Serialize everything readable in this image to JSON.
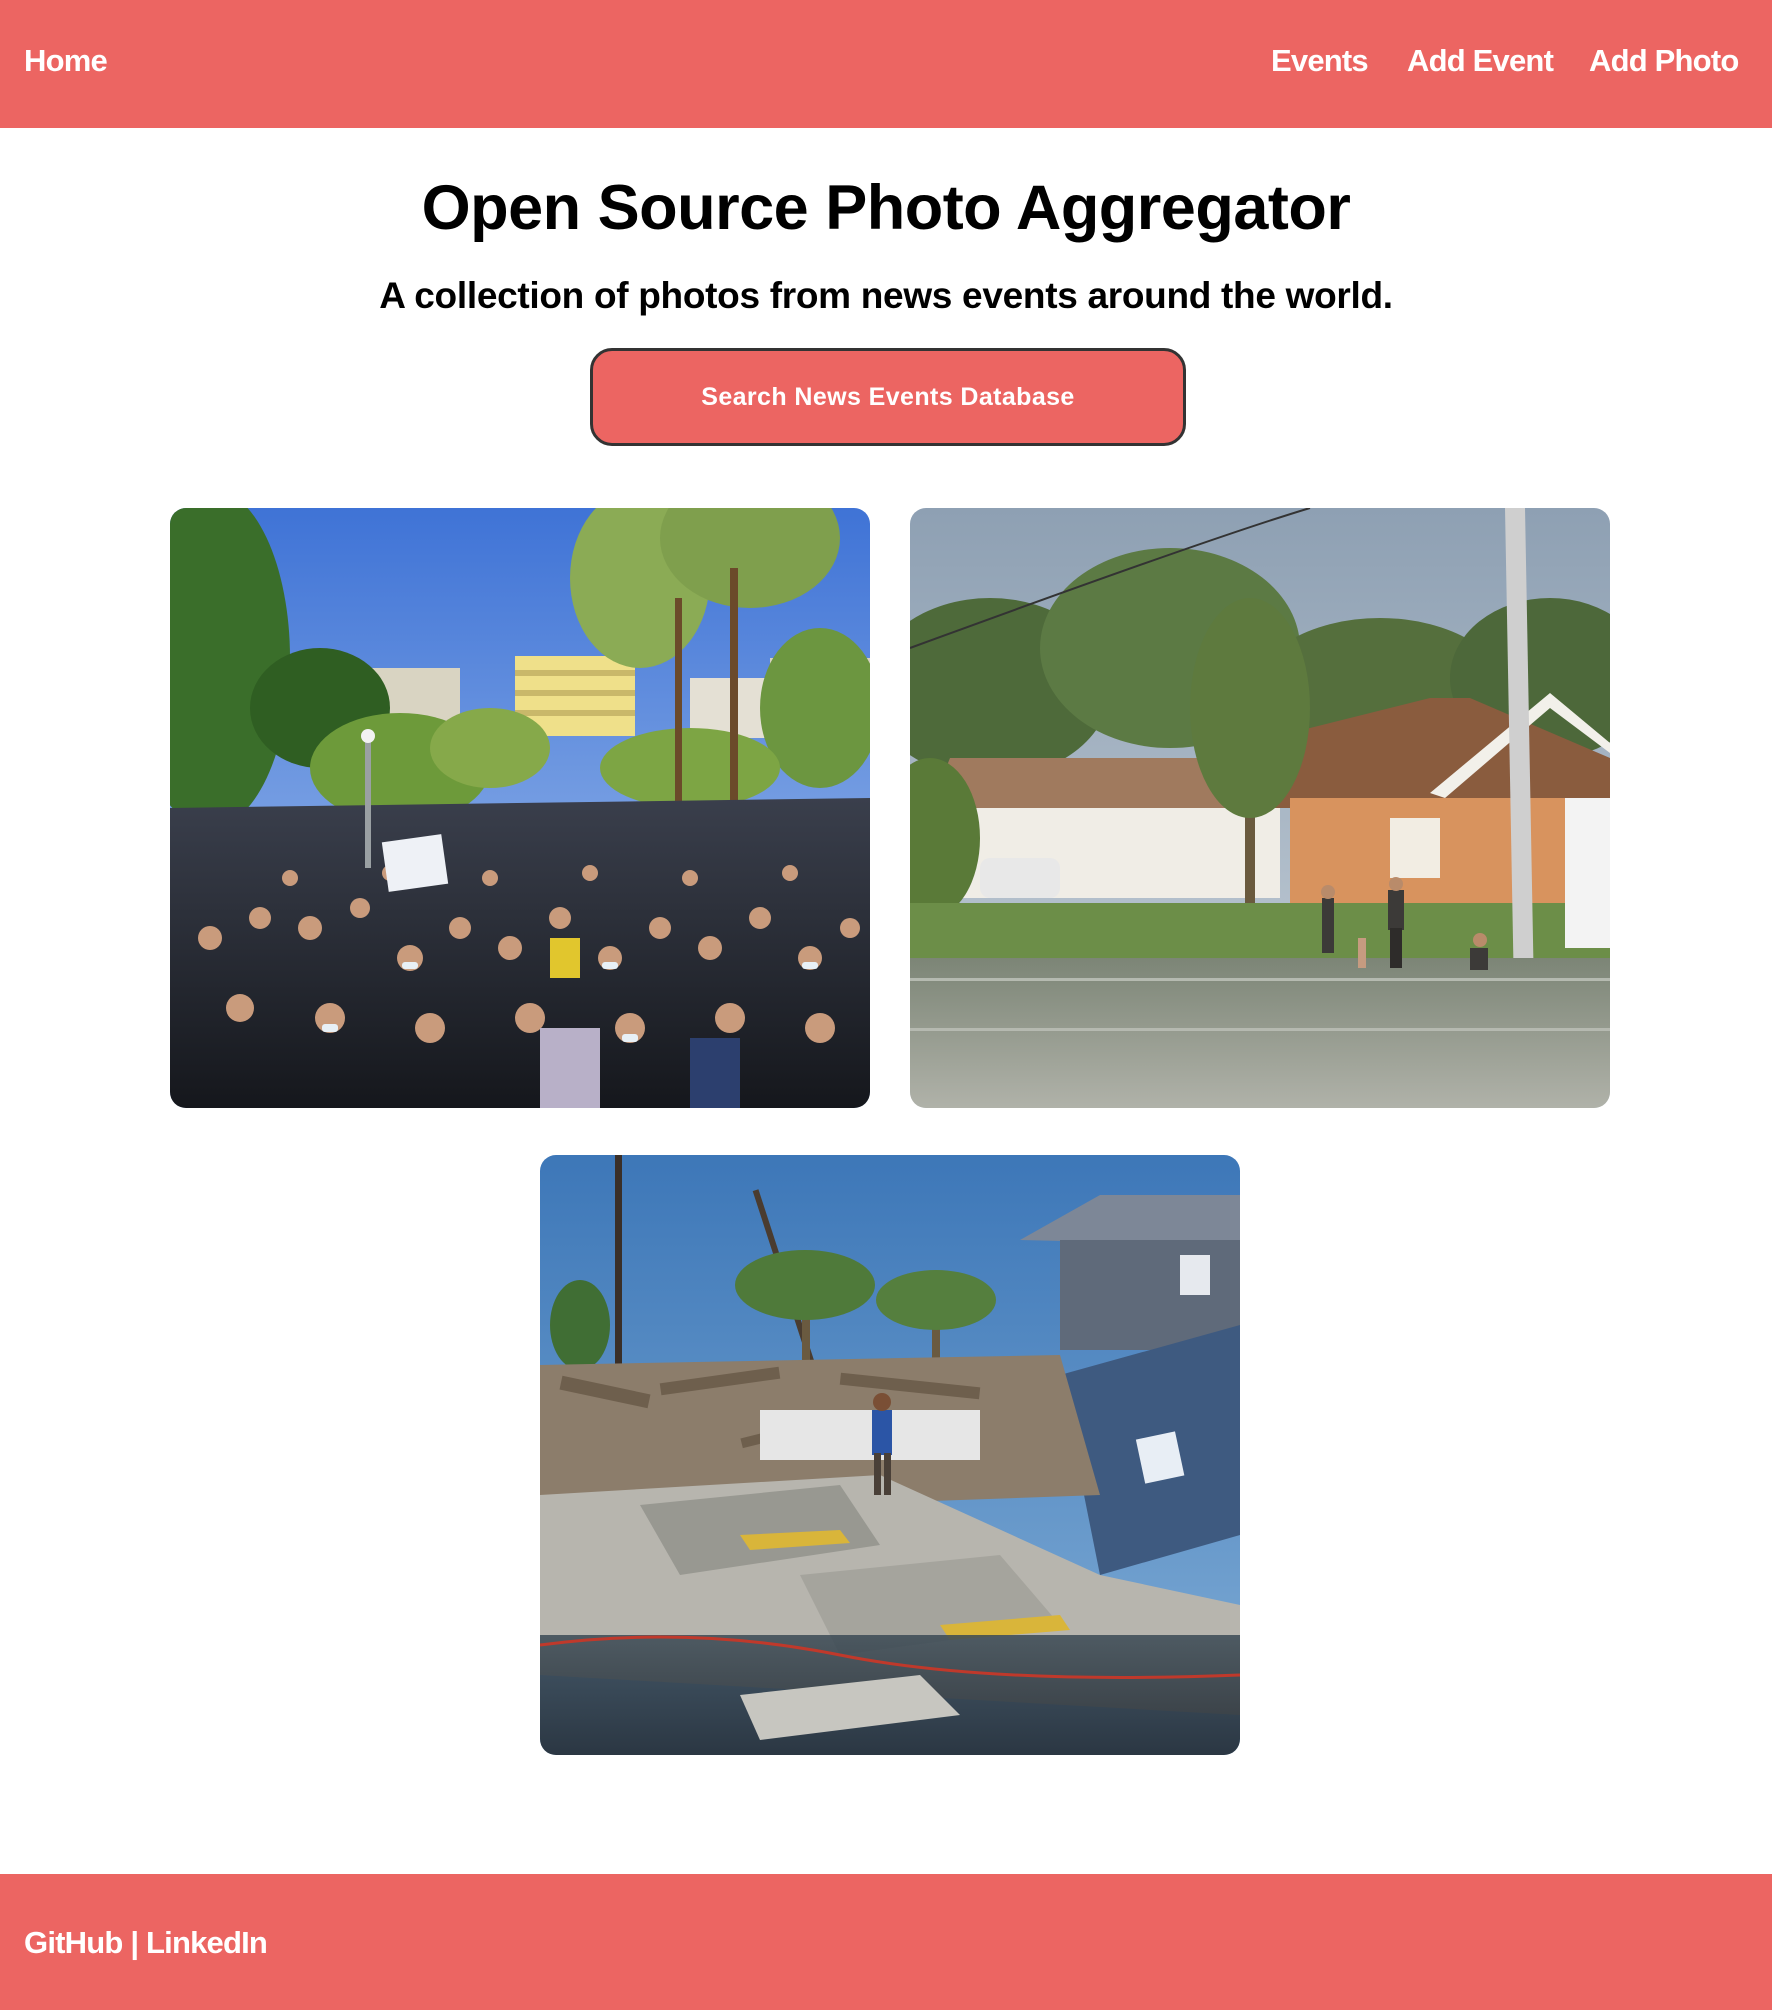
{
  "nav": {
    "home_label": "Home",
    "items": [
      {
        "label": "Events"
      },
      {
        "label": "Add Event"
      },
      {
        "label": "Add Photo"
      }
    ]
  },
  "hero": {
    "title": "Open Source Photo Aggregator",
    "subtitle": "A collection of photos from news events around the world.",
    "search_button_label": "Search News Events Database"
  },
  "photos": [
    {
      "depicts": "protest-crowd"
    },
    {
      "depicts": "flooded-residential-street"
    },
    {
      "depicts": "hurricane-destroyed-houses"
    }
  ],
  "footer": {
    "github_label": "GitHub",
    "separator": " | ",
    "linkedin_label": "LinkedIn"
  },
  "colors": {
    "brand": "#ec6562",
    "text": "#000000",
    "nav_text": "#ffffff",
    "button_border": "#333333"
  }
}
